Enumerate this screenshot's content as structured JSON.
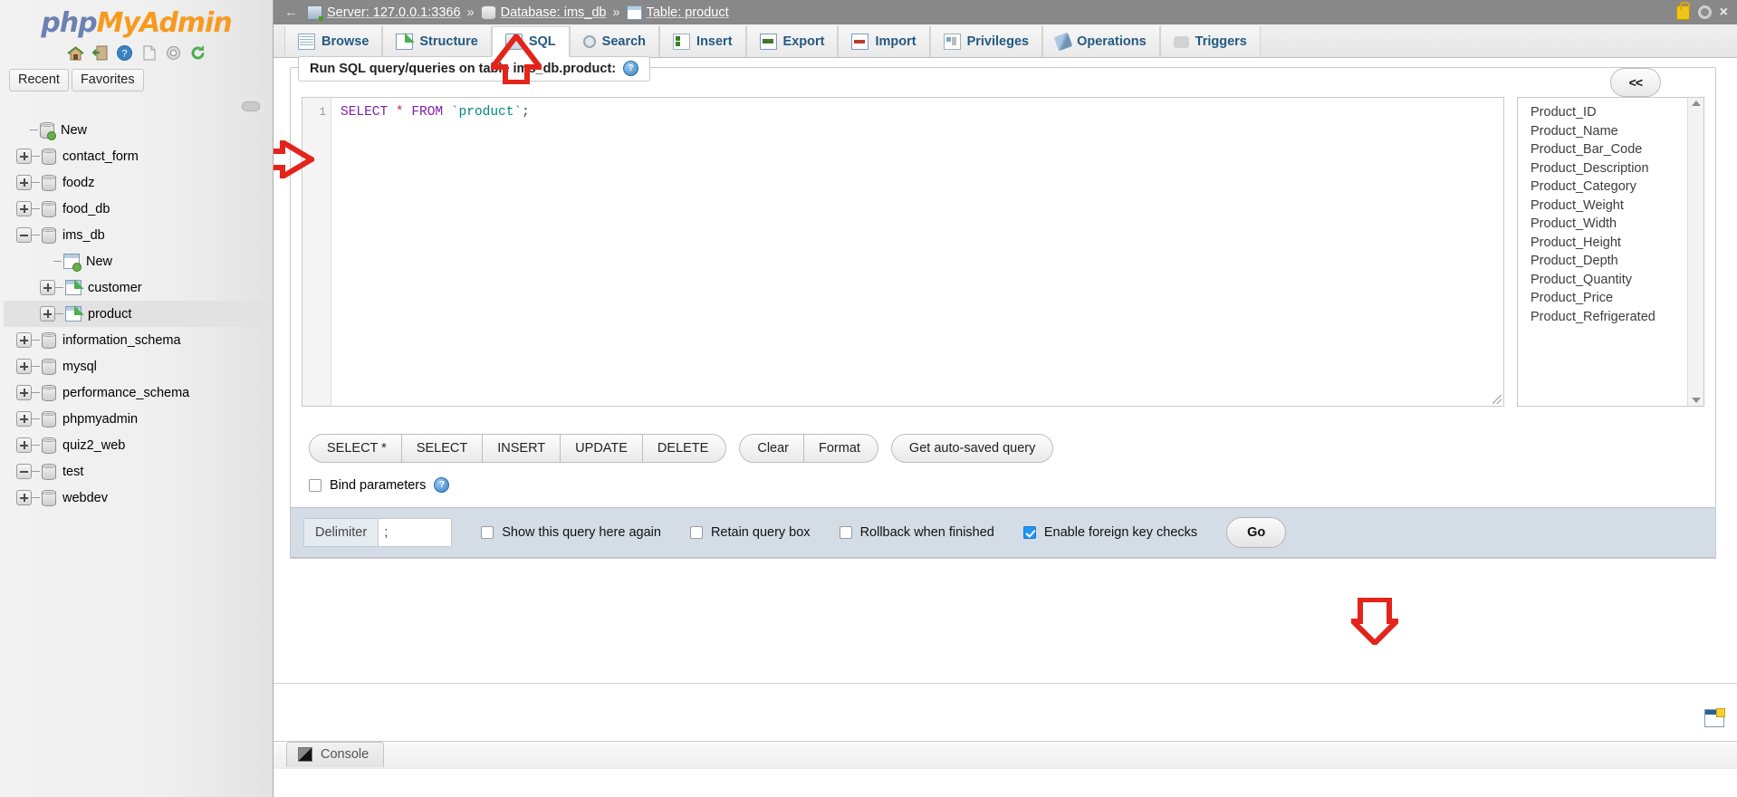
{
  "app": {
    "logo_php": "php",
    "logo_my": "My",
    "logo_admin": "Admin",
    "logo_icons": [
      "home-icon",
      "exit-icon",
      "help-icon",
      "docs-icon",
      "settings-icon",
      "reload-icon"
    ]
  },
  "sidebar": {
    "tabs": [
      {
        "label": "Recent"
      },
      {
        "label": "Favorites"
      }
    ],
    "tree": [
      {
        "label": "New",
        "depth": 0,
        "toggle": "none",
        "icon": "new-database-icon"
      },
      {
        "label": "contact_form",
        "depth": 0,
        "toggle": "plus",
        "icon": "database-icon"
      },
      {
        "label": "foodz",
        "depth": 0,
        "toggle": "plus",
        "icon": "database-icon"
      },
      {
        "label": "food_db",
        "depth": 0,
        "toggle": "plus",
        "icon": "database-icon"
      },
      {
        "label": "ims_db",
        "depth": 0,
        "toggle": "minus",
        "icon": "database-icon"
      },
      {
        "label": "New",
        "depth": 1,
        "toggle": "none",
        "icon": "new-table-icon"
      },
      {
        "label": "customer",
        "depth": 1,
        "toggle": "plus",
        "icon": "table-icon"
      },
      {
        "label": "product",
        "depth": 1,
        "toggle": "plus",
        "icon": "table-icon",
        "selected": true
      },
      {
        "label": "information_schema",
        "depth": 0,
        "toggle": "plus",
        "icon": "database-icon"
      },
      {
        "label": "mysql",
        "depth": 0,
        "toggle": "plus",
        "icon": "database-icon"
      },
      {
        "label": "performance_schema",
        "depth": 0,
        "toggle": "plus",
        "icon": "database-icon"
      },
      {
        "label": "phpmyadmin",
        "depth": 0,
        "toggle": "plus",
        "icon": "database-icon"
      },
      {
        "label": "quiz2_web",
        "depth": 0,
        "toggle": "plus",
        "icon": "database-icon"
      },
      {
        "label": "test",
        "depth": 0,
        "toggle": "minus",
        "icon": "database-icon"
      },
      {
        "label": "webdev",
        "depth": 0,
        "toggle": "plus",
        "icon": "database-icon"
      }
    ]
  },
  "breadcrumb": {
    "back": "←",
    "server": "Server: 127.0.0.1:3366",
    "database": "Database: ims_db",
    "table": "Table: product",
    "sep": "»"
  },
  "tabs": [
    {
      "label": "Browse",
      "icon": "browse-icon",
      "active": false
    },
    {
      "label": "Structure",
      "icon": "structure-icon",
      "active": false
    },
    {
      "label": "SQL",
      "icon": "sql-icon",
      "active": true
    },
    {
      "label": "Search",
      "icon": "search-icon",
      "active": false
    },
    {
      "label": "Insert",
      "icon": "insert-icon",
      "active": false
    },
    {
      "label": "Export",
      "icon": "export-icon",
      "active": false
    },
    {
      "label": "Import",
      "icon": "import-icon",
      "active": false
    },
    {
      "label": "Privileges",
      "icon": "privileges-icon",
      "active": false
    },
    {
      "label": "Operations",
      "icon": "operations-icon",
      "active": false
    },
    {
      "label": "Triggers",
      "icon": "triggers-icon",
      "active": false
    }
  ],
  "sql_panel": {
    "title": "Run SQL query/queries on table ims_db.product:",
    "help_glyph": "?",
    "line_number": "1",
    "query_tokens": {
      "select": "SELECT",
      "star": "*",
      "from": "FROM",
      "backtick_open": "`",
      "table": "product",
      "backtick_close": "`",
      "semicolon": ";"
    },
    "query_text": "SELECT * FROM `product`;",
    "columns": [
      "Product_ID",
      "Product_Name",
      "Product_Bar_Code",
      "Product_Description",
      "Product_Category",
      "Product_Weight",
      "Product_Width",
      "Product_Height",
      "Product_Depth",
      "Product_Quantity",
      "Product_Price",
      "Product_Refrigerated"
    ],
    "buttons_group1": [
      "SELECT *",
      "SELECT",
      "INSERT",
      "UPDATE",
      "DELETE"
    ],
    "buttons_group2": [
      "Clear",
      "Format"
    ],
    "buttons_group3": [
      "Get auto-saved query"
    ],
    "back_button": "<<",
    "bind_parameters": {
      "label": "Bind parameters",
      "checked": false,
      "help_glyph": "?"
    },
    "footer": {
      "delimiter_label": "Delimiter",
      "delimiter_value": ";",
      "checkboxes": [
        {
          "label": "Show this query here again",
          "checked": false
        },
        {
          "label": "Retain query box",
          "checked": false
        },
        {
          "label": "Rollback when finished",
          "checked": false
        },
        {
          "label": "Enable foreign key checks",
          "checked": true
        }
      ],
      "go_label": "Go"
    }
  },
  "console": {
    "label": "Console",
    "icon": "console-icon"
  },
  "colors": {
    "breadcrumb_bg": "#888888",
    "tab_text": "#235a81",
    "accent_orange": "#f79a1e",
    "accent_blue": "#6c80b3",
    "checkbox_checked": "#2196f3",
    "annotation_red": "#e3241b",
    "footer_bg": "#d4dde6"
  }
}
